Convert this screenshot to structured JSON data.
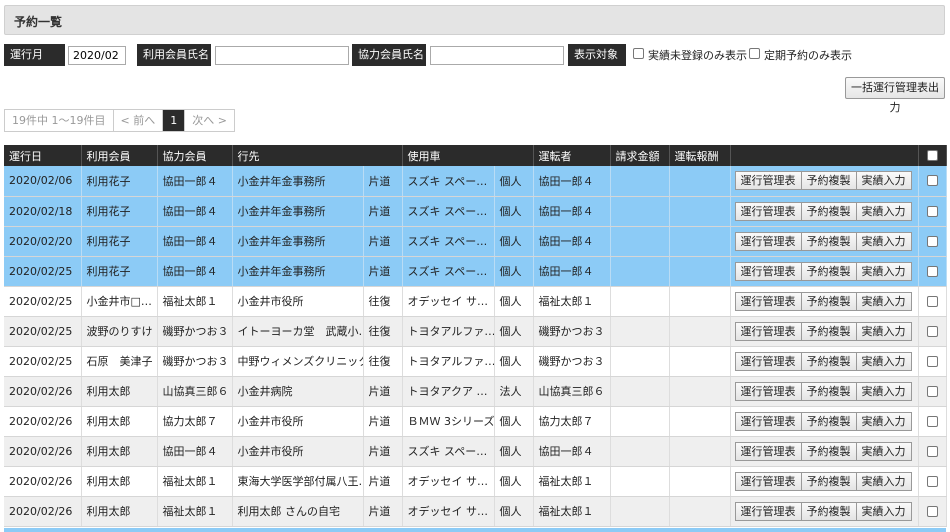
{
  "page": {
    "title": "予約一覧"
  },
  "filters": {
    "month_label": "運行月",
    "month_value": "2020/02",
    "member_label": "利用会員氏名",
    "member_value": "",
    "partner_label": "協力会員氏名",
    "partner_value": "",
    "display_label": "表示対象",
    "opt_unregistered": "実績未登録のみ表示",
    "opt_regular": "定期予約のみ表示"
  },
  "bulk_button": "一括運行管理表出力",
  "pager": {
    "summary": "19件中 1〜19件目",
    "prev": "< 前へ",
    "current": "1",
    "next": "次へ >"
  },
  "table": {
    "headers": [
      "運行日",
      "利用会員",
      "協力会員",
      "行先",
      "",
      "使用車",
      "",
      "運転者",
      "請求金額",
      "運転報酬",
      ""
    ],
    "action_labels": [
      "運行管理表",
      "予約複製",
      "実績入力"
    ],
    "rows": [
      {
        "style": "blue",
        "cells": [
          "2020/02/06",
          "利用花子",
          "協田一郎４",
          "小金井年金事務所",
          "片道",
          "スズキ スペー…",
          "個人",
          "協田一郎４",
          "",
          ""
        ]
      },
      {
        "style": "blue",
        "cells": [
          "2020/02/18",
          "利用花子",
          "協田一郎４",
          "小金井年金事務所",
          "片道",
          "スズキ スペー…",
          "個人",
          "協田一郎４",
          "",
          ""
        ]
      },
      {
        "style": "blue",
        "cells": [
          "2020/02/20",
          "利用花子",
          "協田一郎４",
          "小金井年金事務所",
          "片道",
          "スズキ スペー…",
          "個人",
          "協田一郎４",
          "",
          ""
        ]
      },
      {
        "style": "blue",
        "cells": [
          "2020/02/25",
          "利用花子",
          "協田一郎４",
          "小金井年金事務所",
          "片道",
          "スズキ スペー…",
          "個人",
          "協田一郎４",
          "",
          ""
        ]
      },
      {
        "style": "white",
        "cells": [
          "2020/02/25",
          "小金井市□…",
          "福祉太郎１",
          "小金井市役所",
          "往復",
          "オデッセイ サ…",
          "個人",
          "福祉太郎１",
          "",
          ""
        ]
      },
      {
        "style": "gray",
        "cells": [
          "2020/02/25",
          "波野のりすけ",
          "磯野かつお３",
          "イトーヨーカ堂　武蔵小…",
          "往復",
          "トヨタアルファ…",
          "個人",
          "磯野かつお３",
          "",
          ""
        ]
      },
      {
        "style": "white",
        "cells": [
          "2020/02/25",
          "石原　美津子",
          "磯野かつお３",
          "中野ウィメンズクリニック",
          "往復",
          "トヨタアルファ…",
          "個人",
          "磯野かつお３",
          "",
          ""
        ]
      },
      {
        "style": "gray",
        "cells": [
          "2020/02/26",
          "利用太郎",
          "山協真三郎６",
          "小金井病院",
          "片道",
          "トヨタアクア …",
          "法人",
          "山協真三郎６",
          "",
          ""
        ]
      },
      {
        "style": "white",
        "cells": [
          "2020/02/26",
          "利用太郎",
          "協力太郎７",
          "小金井市役所",
          "片道",
          "ＢＭＷ 3シリーズ",
          "個人",
          "協力太郎７",
          "",
          ""
        ]
      },
      {
        "style": "gray",
        "cells": [
          "2020/02/26",
          "利用太郎",
          "協田一郎４",
          "小金井市役所",
          "片道",
          "スズキ スペー…",
          "個人",
          "協田一郎４",
          "",
          ""
        ]
      },
      {
        "style": "white",
        "cells": [
          "2020/02/26",
          "利用太郎",
          "福祉太郎１",
          "東海大学医学部付属八王…",
          "片道",
          "オデッセイ サ…",
          "個人",
          "福祉太郎１",
          "",
          ""
        ]
      },
      {
        "style": "gray",
        "cells": [
          "2020/02/26",
          "利用太郎",
          "福祉太郎１",
          "利用太郎 さんの自宅",
          "片道",
          "オデッセイ サ…",
          "個人",
          "福祉太郎１",
          "",
          ""
        ]
      }
    ]
  }
}
